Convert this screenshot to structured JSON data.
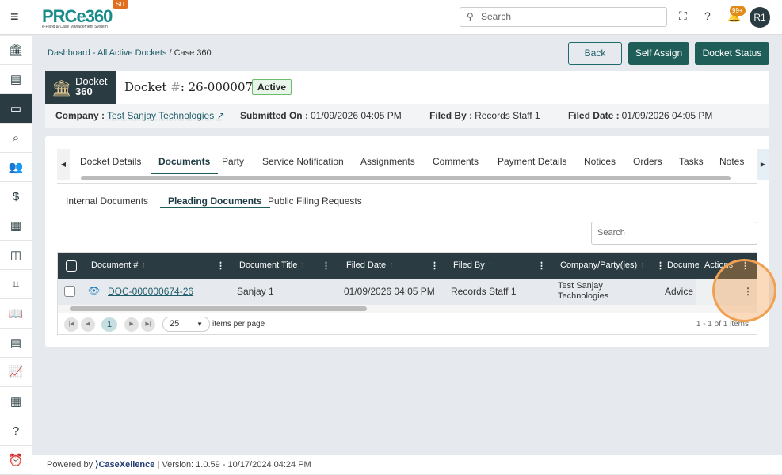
{
  "header": {
    "logo": "PRCe360",
    "logo_sub": "e-Filing & Case Management System",
    "env": "SIT",
    "search_placeholder": "Search",
    "notif_count": "99+",
    "avatar": "R1"
  },
  "breadcrumb": {
    "link": "Dashboard - All Active Dockets",
    "sep": " / ",
    "current": "Case 360"
  },
  "actions": {
    "back": "Back",
    "self_assign": "Self Assign",
    "docket_status": "Docket Status"
  },
  "docket": {
    "badge_line1": "Docket",
    "badge_line2": "360",
    "title_prefix": "Docket ",
    "hash": "#",
    "title_num": ": 26-0000075",
    "status": "Active",
    "company_label": "Company :",
    "company": "Test Sanjay Technologies",
    "submitted_label": "Submitted On :",
    "submitted": "01/09/2026 04:05 PM",
    "filed_by_label": "Filed By :",
    "filed_by": "Records Staff 1",
    "filed_date_label": "Filed Date :",
    "filed_date": "01/09/2026 04:05 PM"
  },
  "tabs": [
    "Docket Details",
    "Documents",
    "Party",
    "Service Notification",
    "Assignments",
    "Comments",
    "Payment Details",
    "Notices",
    "Orders",
    "Tasks",
    "Notes"
  ],
  "subtabs": [
    "Internal Documents",
    "Pleading Documents",
    "Public Filing Requests"
  ],
  "grid": {
    "search_placeholder": "Search",
    "columns": [
      "Document #",
      "Document Title",
      "Filed Date",
      "Filed By",
      "Company/Party(ies)",
      "Docume",
      "Actions"
    ],
    "rows": [
      {
        "doc": "DOC-000000674-26",
        "title": "Sanjay 1",
        "filed_date": "01/09/2026 04:05 PM",
        "filed_by": "Records Staff 1",
        "company": "Test Sanjay Technologies",
        "doctype": "Advice N"
      }
    ],
    "page": "1",
    "page_size": "25",
    "items_per_page": "items per page",
    "summary": "1 - 1 of 1 items"
  },
  "footer": {
    "powered": "Powered by",
    "brand": "CaseXellence",
    "version": "|  Version: 1.0.59 - 10/17/2024 04:24 PM"
  }
}
